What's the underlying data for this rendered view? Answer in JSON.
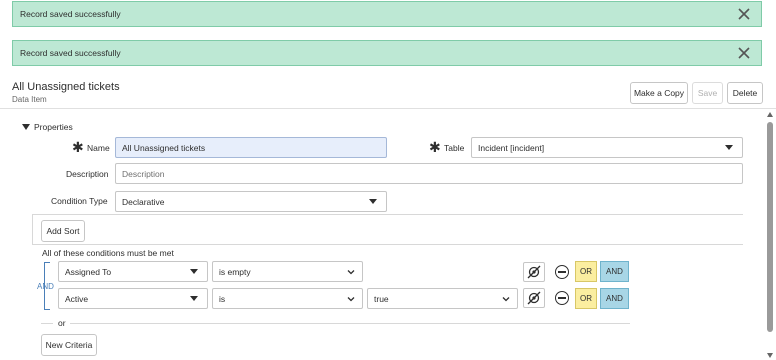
{
  "banners": [
    {
      "message": "Record saved successfully"
    },
    {
      "message": "Record saved successfully"
    }
  ],
  "header": {
    "title": "All Unassigned tickets",
    "subtitle": "Data Item",
    "make_copy_label": "Make a Copy",
    "save_label": "Save",
    "delete_label": "Delete"
  },
  "properties": {
    "section_label": "Properties",
    "name_label": "Name",
    "name_value": "All Unassigned tickets",
    "table_label": "Table",
    "table_value": "Incident [incident]",
    "description_label": "Description",
    "description_placeholder": "Description",
    "condition_type_label": "Condition Type",
    "condition_type_value": "Declarative"
  },
  "sort": {
    "add_sort_label": "Add Sort"
  },
  "conditions": {
    "caption": "All of these conditions must be met",
    "connector": "AND",
    "rows": [
      {
        "field": "Assigned To",
        "operator": "is empty",
        "value": "",
        "or_label": "OR",
        "and_label": "AND"
      },
      {
        "field": "Active",
        "operator": "is",
        "value": "true",
        "or_label": "OR",
        "and_label": "AND"
      }
    ],
    "or_separator": "or",
    "new_criteria_label": "New Criteria"
  },
  "colors": {
    "banner_bg": "#bde8d4",
    "or_bg": "#fbeea0",
    "and_bg": "#a8d6e6",
    "focus_bg": "#e7eefb"
  }
}
